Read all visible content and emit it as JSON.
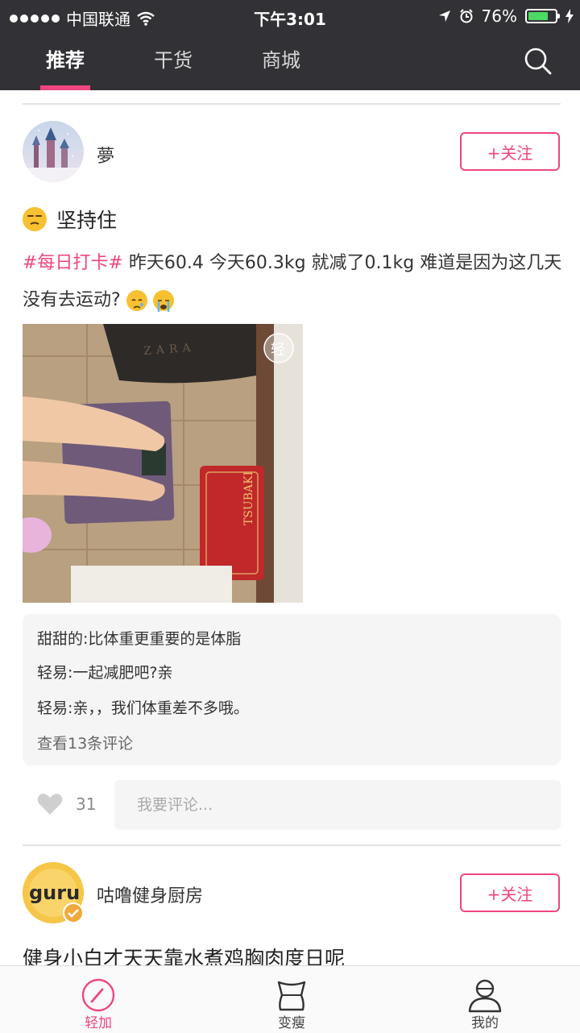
{
  "status_bar": {
    "carrier": "中国联通",
    "time": "下午3:01",
    "battery": "76%",
    "battery_level": 0.76
  },
  "top_nav": {
    "tabs": [
      {
        "label": "推荐",
        "active": true
      },
      {
        "label": "干货",
        "active": false
      },
      {
        "label": "商城",
        "active": false
      }
    ],
    "search_icon": "search-icon"
  },
  "post1": {
    "author": "夢",
    "follow_label": "+关注",
    "title": "坚持住",
    "hashtag": "#每日打卡#",
    "body": " 昨天60.4 今天60.3kg 就减了0.1kg 难道是因为这几天没有去运动?",
    "image_text": {
      "brand_top": "ZARA",
      "box_label": "TSUBAKI",
      "watermark": "轻"
    },
    "comments": [
      {
        "text": "甜甜的:比体重更重要的是体脂"
      },
      {
        "text": "轻易:一起减肥吧?亲"
      },
      {
        "text": "轻易:亲，，我们体重差不多哦。"
      }
    ],
    "view_all": "查看13条评论",
    "like_count": "31",
    "comment_placeholder": "我要评论..."
  },
  "post2": {
    "author": "咕噜健身厨房",
    "avatar_text": "guru",
    "follow_label": "+关注",
    "title": "健身小白才天天靠水煮鸡胸肉度日呢"
  },
  "bottom_bar": {
    "tabs": [
      {
        "label": "轻加",
        "icon": "gauge-icon",
        "active": true
      },
      {
        "label": "变瘦",
        "icon": "scale-waist-icon",
        "active": false
      },
      {
        "label": "我的",
        "icon": "user-icon",
        "active": false
      }
    ]
  },
  "colors": {
    "accent": "#f0457f",
    "nav_bg": "#323236"
  }
}
